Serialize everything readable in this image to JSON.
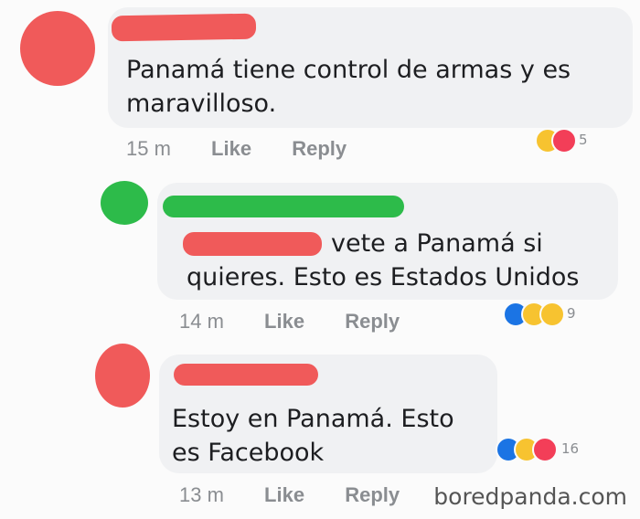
{
  "comments": [
    {
      "text": "Panamá tiene control de armas y es maravilloso.",
      "line1": "Panamá tiene control de armas y es",
      "line2": "maravilloso.",
      "time": "15 m",
      "like_label": "Like",
      "reply_label": "Reply",
      "reactions": [
        "haha",
        "love"
      ],
      "reaction_count": "5"
    },
    {
      "line1": "vete a Panamá si",
      "line2": "quieres. Esto es Estados Unidos",
      "time": "14 m",
      "like_label": "Like",
      "reply_label": "Reply",
      "reactions": [
        "like",
        "haha",
        "wow"
      ],
      "reaction_count": "9"
    },
    {
      "line1": "Estoy en Panamá. Esto",
      "line2": "es Facebook",
      "time": "13 m",
      "like_label": "Like",
      "reply_label": "Reply",
      "reactions": [
        "like",
        "haha",
        "love"
      ],
      "reaction_count": "16"
    }
  ],
  "watermark": "boredpanda.com",
  "colors": {
    "redaction_red": "#f05a5a",
    "redaction_green": "#2dbb4a",
    "bubble": "#f0f1f3"
  }
}
